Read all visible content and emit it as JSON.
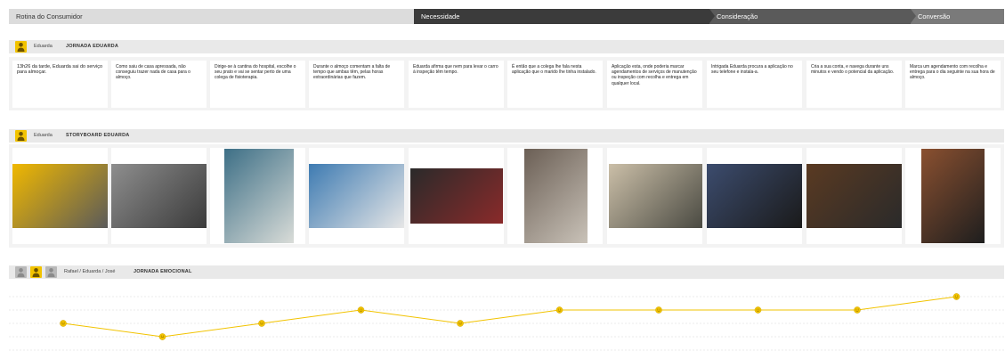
{
  "stages": [
    {
      "label": "Rotina do Consumidor",
      "style": "light"
    },
    {
      "label": "Necessidade",
      "style": "dark",
      "color": "#3b3b3b"
    },
    {
      "label": "Consideração",
      "style": "dark",
      "color": "#5a5a5a"
    },
    {
      "label": "Conversão",
      "style": "dark",
      "color": "#7a7a7a"
    }
  ],
  "journey": {
    "persona": "Eduarda",
    "title": "JORNADA EDUARDA",
    "steps": [
      "13h26 da tarde, Eduarda sai do serviço para almoçar.",
      "Como saiu de casa apressada, não conseguiu trazer nada de casa para o almoço.",
      "Dirige-se à cantina do hospital, escolhe o seu prato e vai se sentar perto de uma colega de fisioterapia.",
      "Durante o almoço comentam a falta de tempo que ambas têm, pelas horas extraordinárias que fazem.",
      "Eduarda afirma que nem para levar o carro à inspeção têm tempo.",
      "É então que a colega lhe fala nesta aplicação que o marido lhe tinha instalado.",
      "Aplicação esta, onde poderia marcar agendamentos de serviços de manutenção ou inspeção com recolha e entrega em qualquer local.",
      "Intrigada Eduarda procura a aplicação no seu telefone e instala-a.",
      "Cria a sua conta, e navega durante uns minutos e vendo o potencial da aplicação.",
      "Marca um agendamento com recolha e entrega para o dia seguinte na sua hora de almoço."
    ]
  },
  "storyboard": {
    "persona": "Eduarda",
    "title": "STORYBOARD EDUARDA",
    "frames": [
      {
        "name": "food-tray-photo",
        "c1": "#f0b800",
        "c2": "#5a5a5a"
      },
      {
        "name": "cantina-trays-photo",
        "c1": "#8e8e8e",
        "c2": "#3a3a3a"
      },
      {
        "name": "hospital-corridor-photo",
        "c1": "#3d6f86",
        "c2": "#d9dcd8"
      },
      {
        "name": "colleagues-talking-photo",
        "c1": "#3e7bb2",
        "c2": "#e6e6e6"
      },
      {
        "name": "car-dashboard-photo",
        "c1": "#2a2a2a",
        "c2": "#8a2a2a"
      },
      {
        "name": "hands-phone-photo",
        "c1": "#6b5f55",
        "c2": "#c9c2b8"
      },
      {
        "name": "man-phone-photo",
        "c1": "#cbbfa8",
        "c2": "#4a4a42"
      },
      {
        "name": "phone-hand-photo",
        "c1": "#3c4c6e",
        "c2": "#1a1a1a"
      },
      {
        "name": "phone-browsing-photo",
        "c1": "#5a3a22",
        "c2": "#2a2a2a"
      },
      {
        "name": "phone-calendar-photo",
        "c1": "#8a5030",
        "c2": "#1e1e1e"
      }
    ]
  },
  "emotional": {
    "personas": "Rafael / Eduarda / José",
    "title": "JORNADA EMOCIONAL",
    "line_color": "#f2c300",
    "levels": [
      1,
      0,
      1,
      2,
      1,
      2,
      2,
      2,
      2,
      3
    ]
  }
}
